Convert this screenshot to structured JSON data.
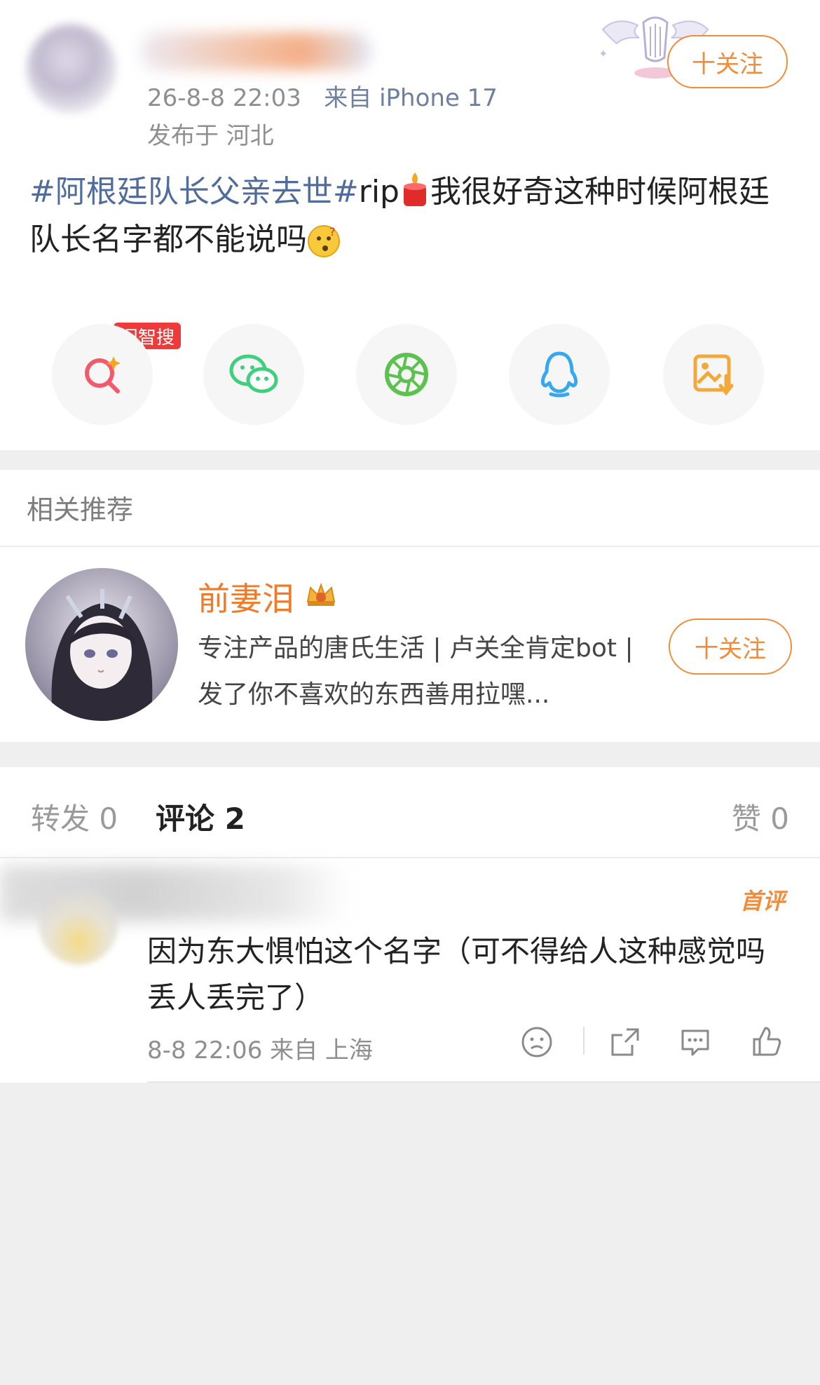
{
  "post": {
    "meta_time": "26-8-8 22:03",
    "meta_source": "来自 iPhone 17",
    "location": "发布于 河北",
    "follow_label": "十关注",
    "topic": "#阿根廷队长父亲去世#",
    "tag_rip": "rip",
    "text_main": "我很好奇这种时候阿根廷队长名字都不能说吗"
  },
  "share": {
    "badge": "问智搜",
    "items": [
      {
        "icon": "ai-search-icon",
        "color": "#f2596a"
      },
      {
        "icon": "wechat-icon",
        "color": "#3fcf7e"
      },
      {
        "icon": "moments-icon",
        "color": "#5cc14f"
      },
      {
        "icon": "qq-icon",
        "color": "#36a8ee"
      },
      {
        "icon": "save-image-icon",
        "color": "#f0a93a"
      }
    ]
  },
  "recommend": {
    "section_title": "相关推荐",
    "name": "前妻泪",
    "desc": "专注产品的唐氏生活 | 卢关全肯定bot | 发了你不喜欢的东西善用拉嘿...",
    "follow_label": "十关注"
  },
  "tabs": {
    "repost": "转发 0",
    "comment": "评论 2",
    "like": "赞 0"
  },
  "comment": {
    "first_badge": "首评",
    "text": "因为东大惧怕这个名字（可不得给人这种感觉吗 丢人丢完了）",
    "meta": "8-8 22:06  来自 上海"
  },
  "colors": {
    "accent_orange": "#f08c3a",
    "topic_blue": "#506c9c",
    "badge_red": "#ee3a3a"
  }
}
